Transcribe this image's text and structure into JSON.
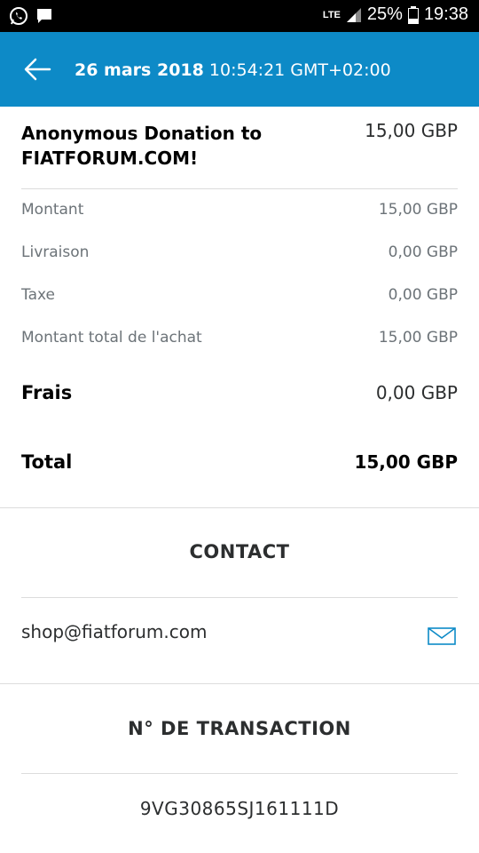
{
  "status_bar": {
    "network": "LTE",
    "battery": "25%",
    "time": "19:38"
  },
  "header": {
    "date": "26 mars 2018",
    "time": "10:54:21 GMT+02:00"
  },
  "item": {
    "title": "Anonymous Donation to FIATFORUM.COM!",
    "amount": "15,00 GBP"
  },
  "details": [
    {
      "label": "Montant",
      "value": "15,00 GBP"
    },
    {
      "label": "Livraison",
      "value": "0,00 GBP"
    },
    {
      "label": "Taxe",
      "value": "0,00 GBP"
    },
    {
      "label": "Montant total de l'achat",
      "value": "15,00 GBP"
    }
  ],
  "fees": {
    "label": "Frais",
    "value": "0,00 GBP"
  },
  "total": {
    "label": "Total",
    "value": "15,00 GBP"
  },
  "contact": {
    "heading": "CONTACT",
    "email": "shop@fiatforum.com"
  },
  "transaction": {
    "heading": "N° DE TRANSACTION",
    "id": "9VG30865SJ161111D"
  },
  "colors": {
    "header_blue": "#0d8ac7",
    "icon_blue": "#0d8ac7",
    "divider": "#dcdcdc"
  }
}
